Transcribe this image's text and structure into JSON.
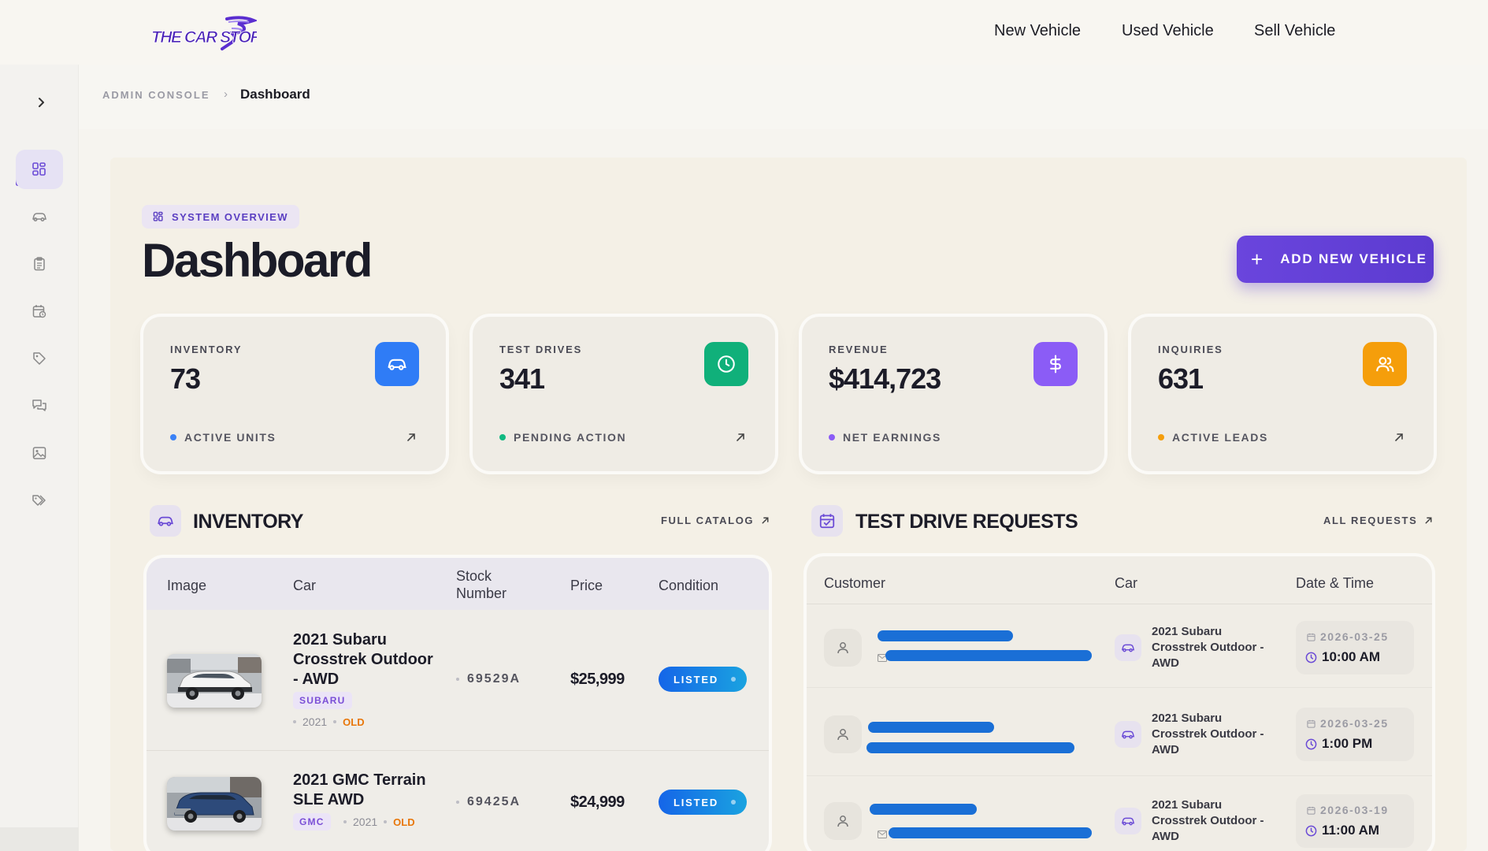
{
  "topnav": {
    "logo_text": "THE CAR STORM",
    "links": [
      "New Vehicle",
      "Used Vehicle",
      "Sell Vehicle"
    ]
  },
  "breadcrumb": {
    "root": "ADMIN CONSOLE",
    "separator": "›",
    "current": "Dashboard"
  },
  "header": {
    "overview_label": "SYSTEM OVERVIEW",
    "title": "Dashboard",
    "add_button": {
      "icon": "plus",
      "label": "ADD NEW VEHICLE"
    }
  },
  "stats": [
    {
      "label": "INVENTORY",
      "value": "73",
      "footer": "ACTIVE UNITS",
      "icon": "car-icon",
      "color": "#2f7cf6",
      "dot": "#3b82f6"
    },
    {
      "label": "TEST DRIVES",
      "value": "341",
      "footer": "PENDING ACTION",
      "icon": "clock-icon",
      "color": "#10b07a",
      "dot": "#10b981"
    },
    {
      "label": "REVENUE",
      "value": "$414,723",
      "footer": "NET EARNINGS",
      "icon": "dollar-icon",
      "color": "#8b5cf6",
      "dot": "#8b5cf6"
    },
    {
      "label": "INQUIRIES",
      "value": "631",
      "footer": "ACTIVE LEADS",
      "icon": "users-icon",
      "color": "#f59e0b",
      "dot": "#f59e0b"
    }
  ],
  "inventory": {
    "title": "INVENTORY",
    "link": "FULL CATALOG",
    "columns": [
      "Image",
      "Car",
      "Stock Number",
      "Price",
      "Condition"
    ],
    "rows": [
      {
        "name": "2021 Subaru Crosstrek Outdoor - AWD",
        "brand": "SUBARU",
        "year": "2021",
        "condition_tag": "OLD",
        "stock": "69529A",
        "price": "$25,999",
        "status": "LISTED"
      },
      {
        "name": "2021 GMC Terrain SLE AWD",
        "brand": "GMC",
        "year": "2021",
        "condition_tag": "OLD",
        "stock": "69425A",
        "price": "$24,999",
        "status": "LISTED"
      }
    ]
  },
  "test_drives": {
    "title": "TEST DRIVE REQUESTS",
    "link": "ALL REQUESTS",
    "columns": [
      "Customer",
      "Car",
      "Date & Time"
    ],
    "rows": [
      {
        "car": "2021 Subaru Crosstrek Outdoor - AWD",
        "date": "2026-03-25",
        "time": "10:00 AM"
      },
      {
        "car": "2021 Subaru Crosstrek Outdoor - AWD",
        "date": "2026-03-25",
        "time": "1:00 PM"
      },
      {
        "car": "2021 Subaru Crosstrek Outdoor - AWD",
        "date": "2026-03-19",
        "time": "11:00 AM"
      }
    ]
  },
  "colors": {
    "accent": "#6a45dd",
    "listed": "#1565e8",
    "old_tag": "#e8770a",
    "redaction": "#1a6fd6"
  }
}
